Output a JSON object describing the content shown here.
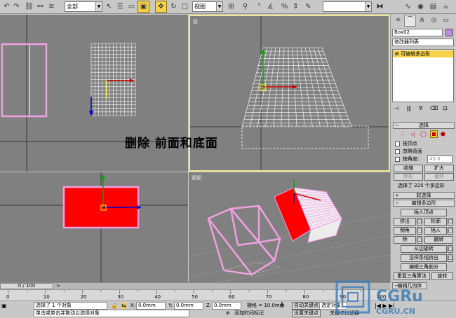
{
  "toolbar": {
    "selection_filter": "全部",
    "ref_coord_system": "视图",
    "named_selection": ""
  },
  "viewports": {
    "top_left": {
      "label": ""
    },
    "top_right": {
      "label": "前"
    },
    "bottom_left": {
      "label": ""
    },
    "bottom_right": {
      "label": "透视"
    }
  },
  "overlay": {
    "instruction": "删除 前面和底面"
  },
  "command_panel": {
    "object_name": "Box02",
    "modifier_list": "修改器列表",
    "stack_item": "可编辑多边形",
    "selection_rollout": "选择",
    "by_vertex": "按顶点",
    "ignore_backfacing": "忽略背面",
    "by_angle": "按角度:",
    "angle_value": "45.0",
    "shrink": "收缩",
    "grow": "扩大",
    "ring": "环形",
    "loop": "循环",
    "selection_status": "选择了 225 个多边形",
    "soft_selection": "软选择",
    "edit_polygons": "编辑多边形",
    "insert_vertex": "插入顶点",
    "extrude": "挤出",
    "outline": "轮廓",
    "bevel": "倒角",
    "inset": "插入",
    "bridge": "桥",
    "flip": "翻转",
    "hinge_from_edge": "从边旋转",
    "extrude_along_spline": "沿样条线挤出",
    "edit_triangulation": "编辑三角剖分",
    "retriangulate": "重复三角算法",
    "turn": "旋转",
    "edit_geometry": "编辑几何体"
  },
  "timeline": {
    "frame": "0 / 100",
    "ticks": [
      "0",
      "10",
      "20",
      "30",
      "40",
      "50",
      "60",
      "70",
      "80",
      "90",
      "100"
    ]
  },
  "status": {
    "selected": "选择了 1 个对象",
    "prompt": "单击或单击并拖动以选择对象",
    "x": "0.0mm",
    "y": "0.0mm",
    "z": "0.0mm",
    "grid": "栅格 = 10.0mm",
    "add_time_tag": "添加时间标记",
    "auto_key": "自动关键点",
    "selected_set": "选定对象",
    "set_key": "设置关键点",
    "key_filters": "关键点过滤器",
    "x_label": "X:",
    "y_label": "Y:",
    "z_label": "Z:"
  },
  "watermark": {
    "text": "CGRU.CN",
    "short": "CGRu"
  },
  "colors": {
    "active_border": "#f0e68c",
    "selected_face": "#ff0000",
    "wire_pink": "#f0a0e0",
    "highlight": "#f6d24a"
  }
}
